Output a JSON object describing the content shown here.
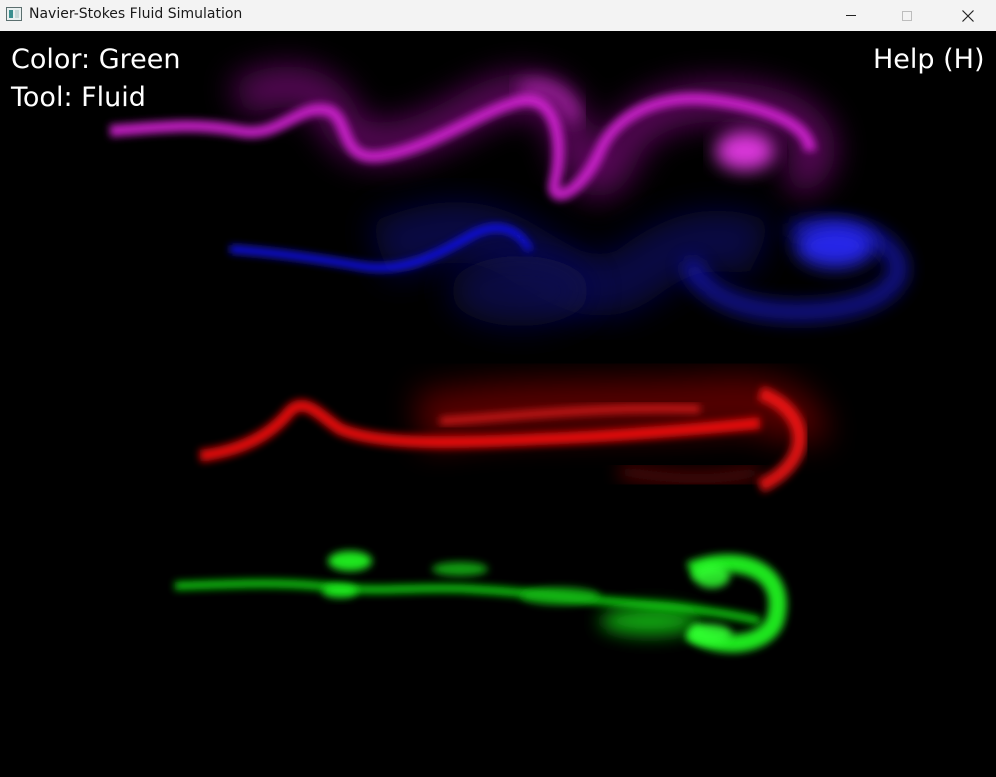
{
  "window": {
    "title": "Navier-Stokes Fluid Simulation",
    "icon": "app-window-icon"
  },
  "controls": {
    "minimize_icon": "minimize-icon",
    "maximize_icon": "maximize-icon",
    "close_icon": "close-icon"
  },
  "hud": {
    "color_text": "Color: Green",
    "tool_text": "Tool: Fluid",
    "help_text": "Help (H)"
  },
  "fluid_streams": [
    {
      "name": "magenta-stream",
      "color": "#ff20ff"
    },
    {
      "name": "blue-stream",
      "color": "#2020ff"
    },
    {
      "name": "red-stream",
      "color": "#ff1010"
    },
    {
      "name": "green-stream",
      "color": "#10ff10"
    }
  ]
}
